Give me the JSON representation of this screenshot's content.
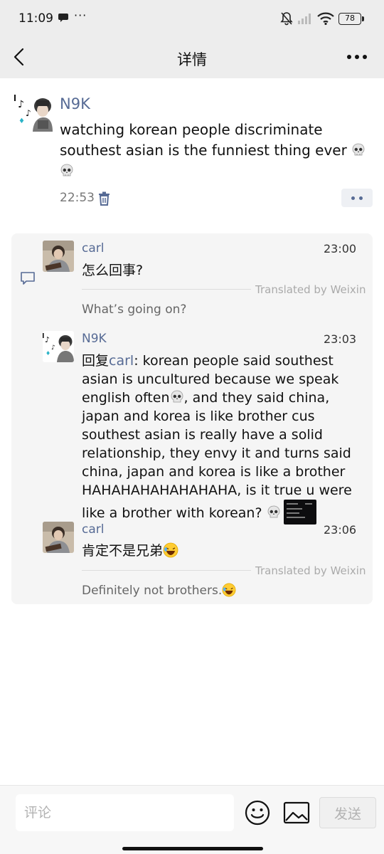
{
  "status_bar": {
    "time": "11:09",
    "dots": "···",
    "battery": "78",
    "icons": [
      "message-icon",
      "mute-bell-icon",
      "signal-icon",
      "wifi-icon",
      "battery-icon"
    ]
  },
  "navbar": {
    "title": "详情",
    "icons": [
      "back-chevron-icon",
      "more-icon"
    ]
  },
  "post": {
    "author": "N9K",
    "text": "watching korean people discriminate southest asian is the funniest thing ever",
    "emojis": [
      "skull-emoji",
      "skull-emoji"
    ],
    "time": "22:53",
    "icons": [
      "delete-icon",
      "more-dots-icon"
    ]
  },
  "comments": [
    {
      "author": "carl",
      "time": "23:00",
      "text": "怎么回事?",
      "translated_label": "Translated by Weixin",
      "translation": "What’s going on?"
    },
    {
      "author": "N9K",
      "time": "23:03",
      "reply_prefix": "回复",
      "reply_to": "carl",
      "text_part1": ": korean people said southest asian is uncultured because we speak english often",
      "text_part2": ", and they said china, japan and korea is like brother cus southest asian is really have a solid relationship, they envy it and turns said china, japan and korea is like a brother HAHAHAHAHAHAHAHA, is it true u were like a brother with korean?"
    },
    {
      "author": "carl",
      "time": "23:06",
      "text": "肯定不是兄弟",
      "translated_label": "Translated by Weixin",
      "translation": "Definitely not brothers."
    }
  ],
  "bottom_bar": {
    "placeholder": "评论",
    "send_label": "发送",
    "icons": [
      "emoji-icon",
      "image-icon"
    ]
  },
  "colors": {
    "link_blue": "#576b95",
    "bar_background": "#ededed",
    "comment_background": "#f5f5f5"
  }
}
